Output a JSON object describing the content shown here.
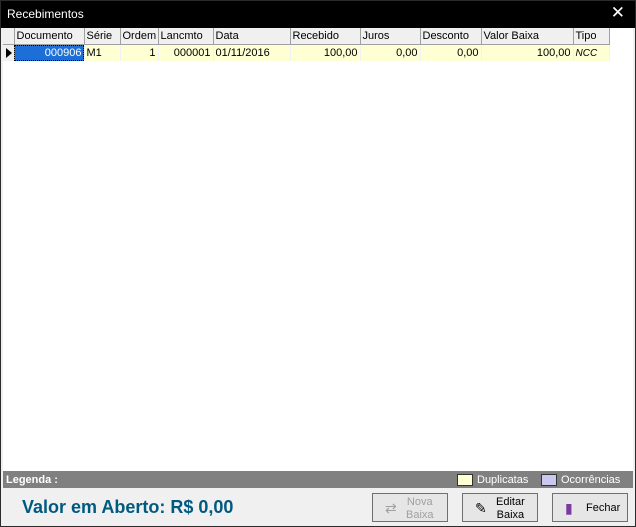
{
  "window": {
    "title": "Recebimentos",
    "close_glyph": "✕"
  },
  "grid": {
    "columns": [
      "Documento",
      "Série",
      "Ordem",
      "Lancmto",
      "Data",
      "Recebido",
      "Juros",
      "Desconto",
      "Valor Baixa",
      "Tipo"
    ],
    "rows": [
      {
        "documento": "000906",
        "serie": "M1",
        "ordem": "1",
        "lancmto": "000001",
        "data": "01/11/2016",
        "recebido": "100,00",
        "juros": "0,00",
        "desconto": "0,00",
        "valor_baixa": "100,00",
        "tipo": "NCC"
      }
    ]
  },
  "legend": {
    "label": "Legenda :",
    "items": [
      {
        "label": "Duplicatas",
        "color": "#ffffd4"
      },
      {
        "label": "Ocorrências",
        "color": "#c8c8f0"
      }
    ]
  },
  "footer": {
    "valor_aberto": "Valor em Aberto: R$ 0,00",
    "buttons": {
      "nova_baixa": {
        "line1": "Nova",
        "line2": "Baixa",
        "icon": "add-transfer-icon",
        "enabled": false
      },
      "editar_baixa": {
        "line1": "Editar",
        "line2": "Baixa",
        "icon": "edit-document-icon",
        "enabled": true
      },
      "fechar": {
        "label": "Fechar",
        "icon": "door-exit-icon",
        "enabled": true
      }
    }
  },
  "colors": {
    "duplicatas": "#ffffd4",
    "ocorrencias": "#c8c8f0",
    "selection": "#1c6fd6",
    "accent_text": "#005a7f"
  }
}
